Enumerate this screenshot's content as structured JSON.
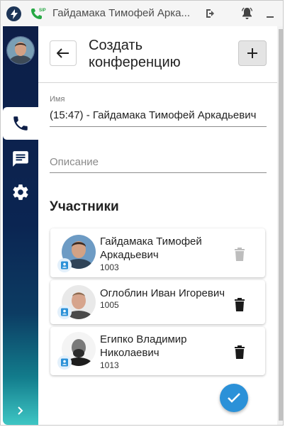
{
  "window": {
    "title": "Гайдамака Тимофей Арка..."
  },
  "sidebar": {
    "nav_items": [
      "phone",
      "chat",
      "settings"
    ],
    "active": "phone"
  },
  "header": {
    "title": "Создать конференцию"
  },
  "form": {
    "name_label": "Имя",
    "name_value": "(15:47) - Гайдамака Тимофей Аркадьевич",
    "description_placeholder": "Описание"
  },
  "participants": {
    "title": "Участники",
    "items": [
      {
        "name": "Гайдамака Тимофей Аркадьевич",
        "ext": "1003",
        "delete_enabled": false
      },
      {
        "name": "Оглоблин Иван Игоревич",
        "ext": "1005",
        "delete_enabled": true
      },
      {
        "name": "Египко Владимир Николаевич",
        "ext": "1013",
        "delete_enabled": true
      }
    ]
  },
  "colors": {
    "accent": "#2b91d8",
    "sidebar_top": "#0d1e47",
    "sidebar_bottom": "#3ec6c4",
    "sip_green": "#27a844"
  }
}
